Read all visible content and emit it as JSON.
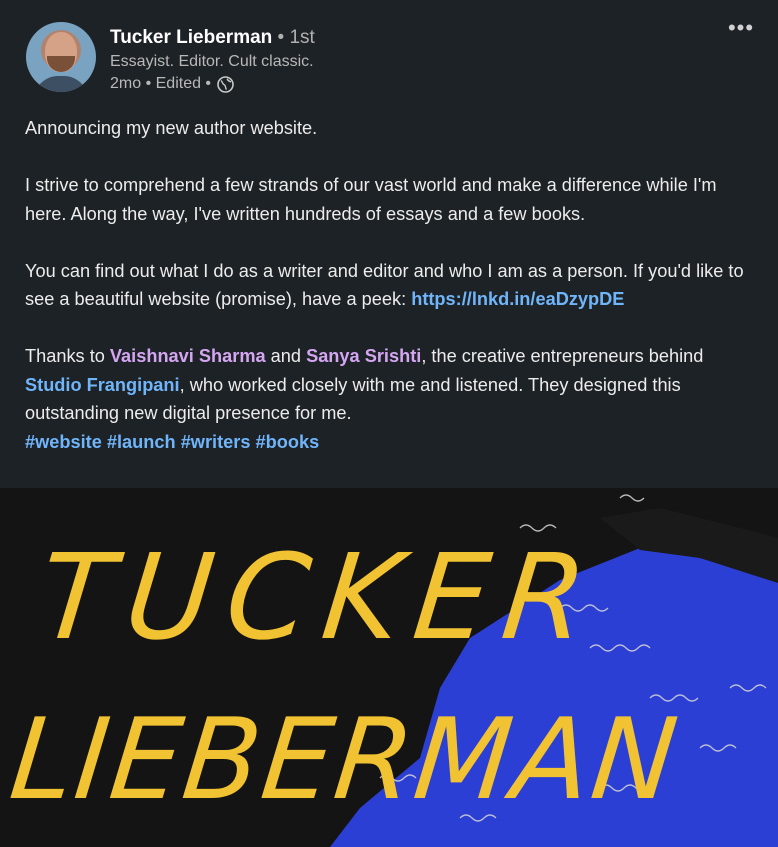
{
  "author": {
    "name": "Tucker Lieberman",
    "degree": " • 1st",
    "headline": "Essayist. Editor. Cult classic.",
    "time": "2mo • Edited •"
  },
  "menu": {
    "more_label": "•••"
  },
  "post": {
    "p1": "Announcing my new author website.",
    "p2": "I strive to comprehend a few strands of our vast world and make a difference while I'm here. Along the way, I've written hundreds of essays and a few books.",
    "p3_text": "You can find out what I do as a writer and editor and who I am as a person. If you'd like to see a beautiful website (promise), have a peek: ",
    "p3_link": "https://lnkd.in/eaDzypDE",
    "p4_a": "Thanks to ",
    "mention1": "Vaishnavi Sharma",
    "p4_b": " and ",
    "mention2": "Sanya Srishti",
    "p4_c": ", the creative entrepreneurs behind ",
    "company": "Studio Frangipani",
    "p4_d": ", who worked closely with me and listened. They designed this outstanding new digital presence for me.",
    "hashtags": [
      "#website",
      "#launch",
      "#writers",
      "#books"
    ]
  },
  "image": {
    "line1": "TUCKER",
    "line2": "LIEBERMAN",
    "text_color": "#f1c232",
    "bg_color": "#141414",
    "accent_color": "#2c3fd4"
  },
  "colors": {
    "background": "#1d2226",
    "link": "#70b5f9",
    "mention": "#d4a6f2"
  }
}
